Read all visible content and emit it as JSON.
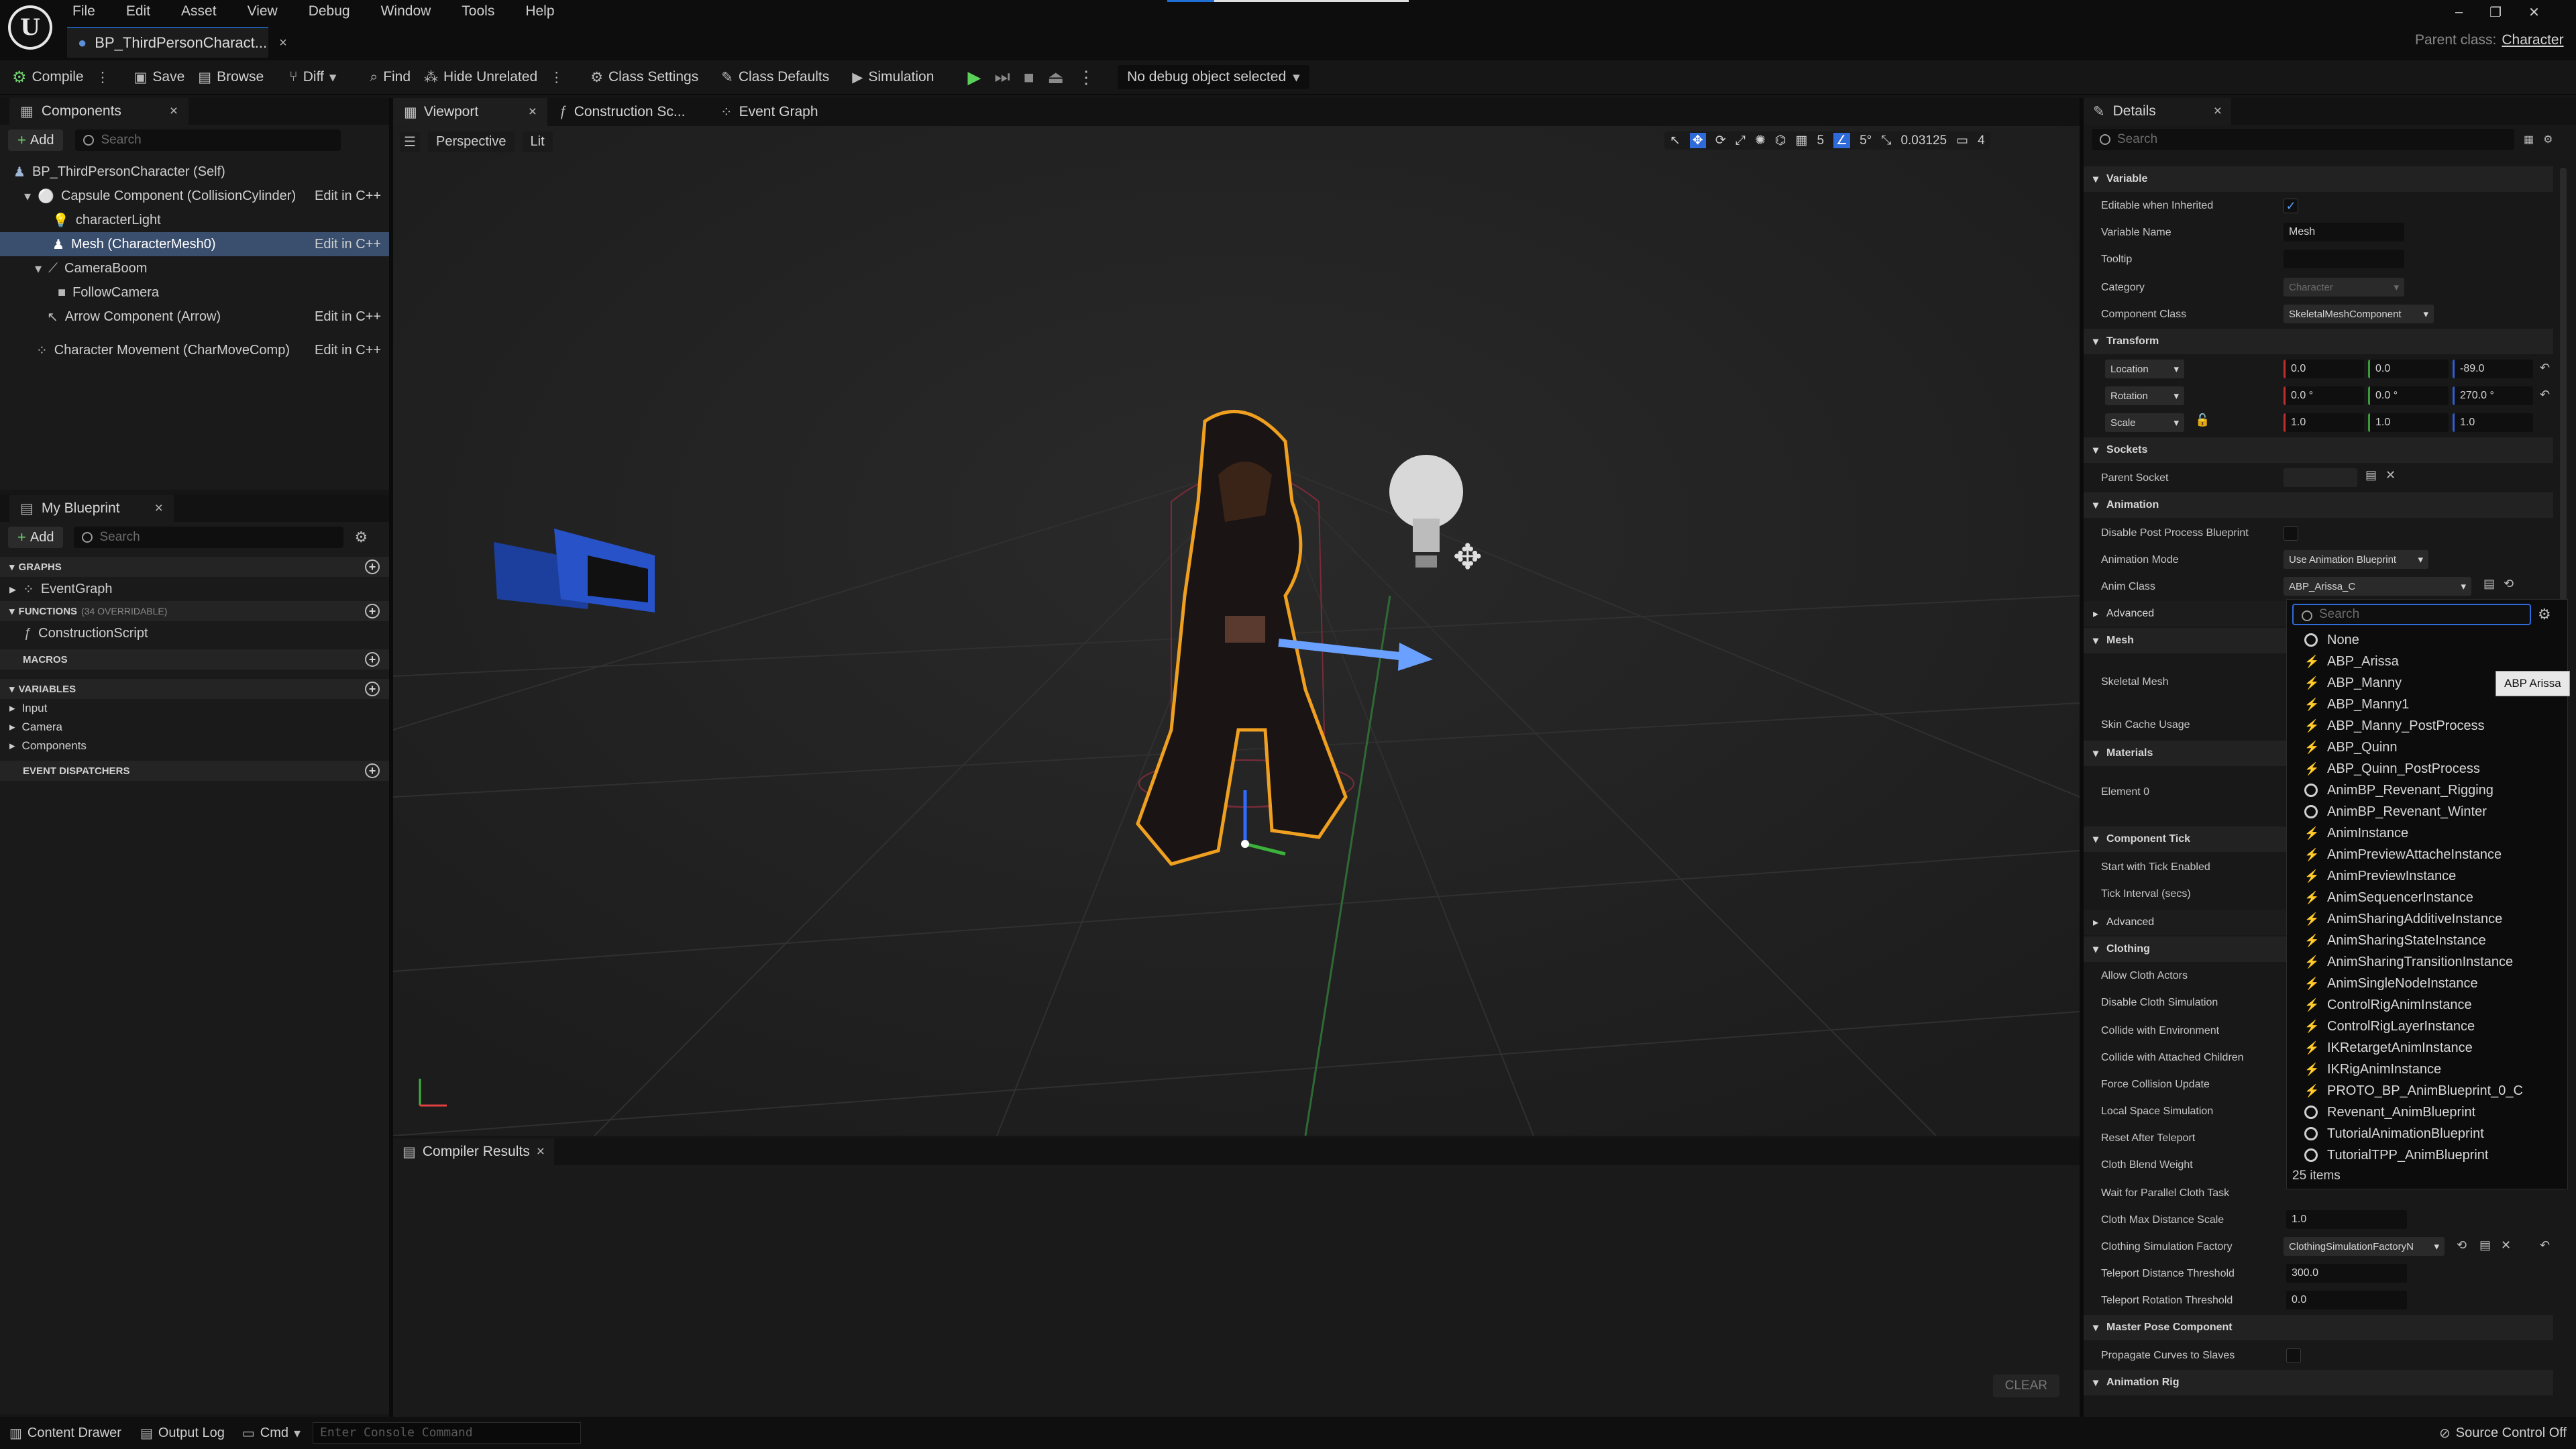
{
  "app": {
    "logo": "unreal-logo",
    "menu": [
      "File",
      "Edit",
      "Asset",
      "View",
      "Debug",
      "Window",
      "Tools",
      "Help"
    ],
    "doc_tab": "BP_ThirdPersonCharact...",
    "parent_class_label": "Parent class:",
    "parent_class_value": "Character"
  },
  "toolbar": {
    "compile": "Compile",
    "save": "Save",
    "browse": "Browse",
    "diff": "Diff",
    "find": "Find",
    "hide_unrelated": "Hide Unrelated",
    "class_settings": "Class Settings",
    "class_defaults": "Class Defaults",
    "simulation": "Simulation",
    "debug_object": "No debug object selected"
  },
  "components": {
    "tab": "Components",
    "add": "Add",
    "search_placeholder": "Search",
    "items": [
      {
        "label": "BP_ThirdPersonCharacter (Self)",
        "edit": ""
      },
      {
        "label": "Capsule Component (CollisionCylinder)",
        "edit": "Edit in C++"
      },
      {
        "label": "characterLight",
        "edit": ""
      },
      {
        "label": "Mesh (CharacterMesh0)",
        "edit": "Edit in C++"
      },
      {
        "label": "CameraBoom",
        "edit": ""
      },
      {
        "label": "FollowCamera",
        "edit": ""
      },
      {
        "label": "Arrow Component (Arrow)",
        "edit": "Edit in C++"
      },
      {
        "label": "Character Movement (CharMoveComp)",
        "edit": "Edit in C++"
      }
    ]
  },
  "my_blueprint": {
    "tab": "My Blueprint",
    "add": "Add",
    "search_placeholder": "Search",
    "graphs": "GRAPHS",
    "event_graph": "EventGraph",
    "functions": "FUNCTIONS",
    "functions_count": "(34 OVERRIDABLE)",
    "construction_script": "ConstructionScript",
    "macros": "MACROS",
    "variables": "VARIABLES",
    "var_input": "Input",
    "var_camera": "Camera",
    "var_components": "Components",
    "event_dispatchers": "EVENT DISPATCHERS"
  },
  "editor_tabs": {
    "viewport": "Viewport",
    "construction": "Construction Sc...",
    "event_graph": "Event Graph"
  },
  "viewport": {
    "perspective": "Perspective",
    "lit": "Lit",
    "grid_size": "5",
    "rot_snap": "5°",
    "scale_snap": "0.03125",
    "camera_speed": "4"
  },
  "compiler": {
    "tab": "Compiler Results",
    "clear": "CLEAR"
  },
  "details": {
    "tab": "Details",
    "search_placeholder": "Search",
    "variable": "Variable",
    "editable_inherited": "Editable when Inherited",
    "variable_name": "Variable Name",
    "variable_name_value": "Mesh",
    "tooltip": "Tooltip",
    "category": "Category",
    "category_value": "Character",
    "component_class": "Component Class",
    "component_class_value": "SkeletalMeshComponent",
    "transform": "Transform",
    "location": "Location",
    "location_values": [
      "0.0",
      "0.0",
      "-89.0"
    ],
    "rotation": "Rotation",
    "rotation_values": [
      "0.0 °",
      "0.0 °",
      "270.0 °"
    ],
    "scale": "Scale",
    "scale_values": [
      "1.0",
      "1.0",
      "1.0"
    ],
    "sockets": "Sockets",
    "parent_socket": "Parent Socket",
    "animation": "Animation",
    "disable_pp": "Disable Post Process Blueprint",
    "animation_mode": "Animation Mode",
    "animation_mode_value": "Use Animation Blueprint",
    "anim_class": "Anim Class",
    "anim_class_value": "ABP_Arissa_C",
    "advanced": "Advanced",
    "mesh": "Mesh",
    "skeletal_mesh": "Skeletal Mesh",
    "skin_cache": "Skin Cache Usage",
    "materials": "Materials",
    "element0": "Element 0",
    "component_tick": "Component Tick",
    "start_tick": "Start with Tick Enabled",
    "tick_interval": "Tick Interval (secs)",
    "advanced2": "Advanced",
    "clothing": "Clothing",
    "allow_cloth": "Allow Cloth Actors",
    "disable_cloth": "Disable Cloth Simulation",
    "collide_env": "Collide with Environment",
    "collide_attached": "Collide with Attached Children",
    "force_collision": "Force Collision Update",
    "local_space": "Local Space Simulation",
    "reset_teleport": "Reset After Teleport",
    "cloth_blend": "Cloth Blend Weight",
    "wait_parallel": "Wait for Parallel Cloth Task",
    "cloth_max_dist": "Cloth Max Distance Scale",
    "cloth_max_dist_value": "1.0",
    "cloth_factory": "Clothing Simulation Factory",
    "cloth_factory_value": "ClothingSimulationFactoryN",
    "teleport_dist": "Teleport Distance Threshold",
    "teleport_dist_value": "300.0",
    "teleport_rot": "Teleport Rotation Threshold",
    "teleport_rot_value": "0.0",
    "master_pose": "Master Pose Component",
    "propagate": "Propagate Curves to Slaves",
    "animation_rig": "Animation Rig"
  },
  "anim_picker": {
    "search_placeholder": "Search",
    "tooltip": "ABP Arissa",
    "count": "25 items",
    "items": [
      {
        "label": "None",
        "kind": "radio"
      },
      {
        "label": "ABP_Arissa",
        "kind": "anim"
      },
      {
        "label": "ABP_Manny",
        "kind": "anim"
      },
      {
        "label": "ABP_Manny1",
        "kind": "anim"
      },
      {
        "label": "ABP_Manny_PostProcess",
        "kind": "anim"
      },
      {
        "label": "ABP_Quinn",
        "kind": "anim"
      },
      {
        "label": "ABP_Quinn_PostProcess",
        "kind": "anim"
      },
      {
        "label": "AnimBP_Revenant_Rigging",
        "kind": "radio"
      },
      {
        "label": "AnimBP_Revenant_Winter",
        "kind": "radio"
      },
      {
        "label": "AnimInstance",
        "kind": "anim"
      },
      {
        "label": "AnimPreviewAttacheInstance",
        "kind": "anim"
      },
      {
        "label": "AnimPreviewInstance",
        "kind": "anim"
      },
      {
        "label": "AnimSequencerInstance",
        "kind": "anim"
      },
      {
        "label": "AnimSharingAdditiveInstance",
        "kind": "anim"
      },
      {
        "label": "AnimSharingStateInstance",
        "kind": "anim"
      },
      {
        "label": "AnimSharingTransitionInstance",
        "kind": "anim"
      },
      {
        "label": "AnimSingleNodeInstance",
        "kind": "anim"
      },
      {
        "label": "ControlRigAnimInstance",
        "kind": "anim"
      },
      {
        "label": "ControlRigLayerInstance",
        "kind": "anim"
      },
      {
        "label": "IKRetargetAnimInstance",
        "kind": "anim"
      },
      {
        "label": "IKRigAnimInstance",
        "kind": "anim"
      },
      {
        "label": "PROTO_BP_AnimBlueprint_0_C",
        "kind": "anim"
      },
      {
        "label": "Revenant_AnimBlueprint",
        "kind": "radio"
      },
      {
        "label": "TutorialAnimationBlueprint",
        "kind": "radio"
      },
      {
        "label": "TutorialTPP_AnimBlueprint",
        "kind": "radio"
      }
    ]
  },
  "statusbar": {
    "content_drawer": "Content Drawer",
    "output_log": "Output Log",
    "cmd": "Cmd",
    "console_placeholder": "Enter Console Command",
    "source_control": "Source Control Off"
  }
}
